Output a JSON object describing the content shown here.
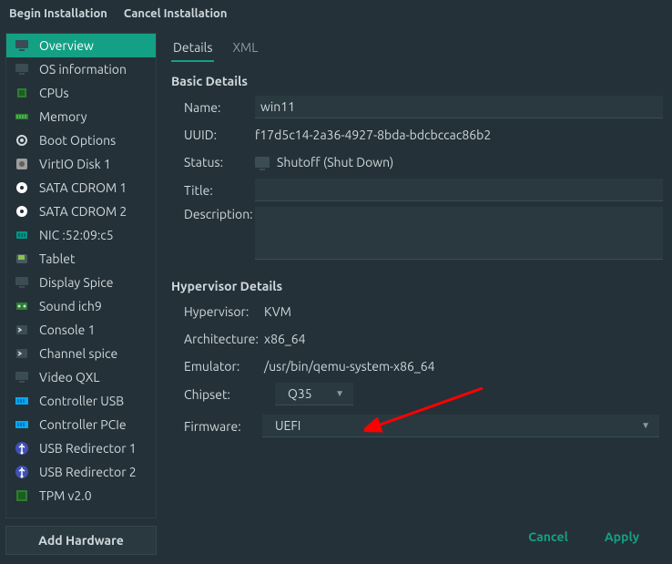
{
  "topbar": {
    "begin": "Begin Installation",
    "cancel": "Cancel Installation"
  },
  "sidebar": {
    "items": [
      {
        "label": "Overview",
        "icon": "monitor"
      },
      {
        "label": "OS information",
        "icon": "monitor"
      },
      {
        "label": "CPUs",
        "icon": "chip"
      },
      {
        "label": "Memory",
        "icon": "memory"
      },
      {
        "label": "Boot Options",
        "icon": "gear"
      },
      {
        "label": "VirtIO Disk 1",
        "icon": "disk"
      },
      {
        "label": "SATA CDROM 1",
        "icon": "cd"
      },
      {
        "label": "SATA CDROM 2",
        "icon": "cd"
      },
      {
        "label": "NIC :52:09:c5",
        "icon": "nic"
      },
      {
        "label": "Tablet",
        "icon": "tablet"
      },
      {
        "label": "Display Spice",
        "icon": "monitor"
      },
      {
        "label": "Sound ich9",
        "icon": "sound"
      },
      {
        "label": "Console 1",
        "icon": "console"
      },
      {
        "label": "Channel spice",
        "icon": "console"
      },
      {
        "label": "Video QXL",
        "icon": "monitor"
      },
      {
        "label": "Controller USB",
        "icon": "ctrl"
      },
      {
        "label": "Controller PCIe",
        "icon": "ctrl"
      },
      {
        "label": "USB Redirector 1",
        "icon": "usb"
      },
      {
        "label": "USB Redirector 2",
        "icon": "usb"
      },
      {
        "label": "TPM v2.0",
        "icon": "tpm"
      }
    ],
    "selected_index": 0,
    "add_hardware": "Add Hardware"
  },
  "tabs": {
    "details": "Details",
    "xml": "XML",
    "active": "details"
  },
  "basic": {
    "heading": "Basic Details",
    "name_label": "Name:",
    "name_value": "win11",
    "uuid_label": "UUID:",
    "uuid_value": "f17d5c14-2a36-4927-8bda-bdcbccac86b2",
    "status_label": "Status:",
    "status_value": "Shutoff (Shut Down)",
    "title_label": "Title:",
    "title_value": "",
    "desc_label": "Description:",
    "desc_value": ""
  },
  "hyper": {
    "heading": "Hypervisor Details",
    "hv_label": "Hypervisor:",
    "hv_value": "KVM",
    "arch_label": "Architecture:",
    "arch_value": "x86_64",
    "emu_label": "Emulator:",
    "emu_value": "/usr/bin/qemu-system-x86_64",
    "chipset_label": "Chipset:",
    "chipset_value": "Q35",
    "firmware_label": "Firmware:",
    "firmware_value": "UEFI"
  },
  "footer": {
    "cancel": "Cancel",
    "apply": "Apply"
  },
  "icons": {
    "monitor": "#3b4c55",
    "chip": "#2e7d32",
    "memory": "#2e7d32",
    "gear": "#cfd8dc",
    "disk": "#9e9e9e",
    "cd": "#ffffff",
    "nic": "#009688",
    "tablet": "#8bc34a",
    "sound": "#2e7d32",
    "console": "#3b4c55",
    "ctrl": "#03a9f4",
    "usb": "#3f51b5",
    "tpm": "#2e7d32"
  }
}
